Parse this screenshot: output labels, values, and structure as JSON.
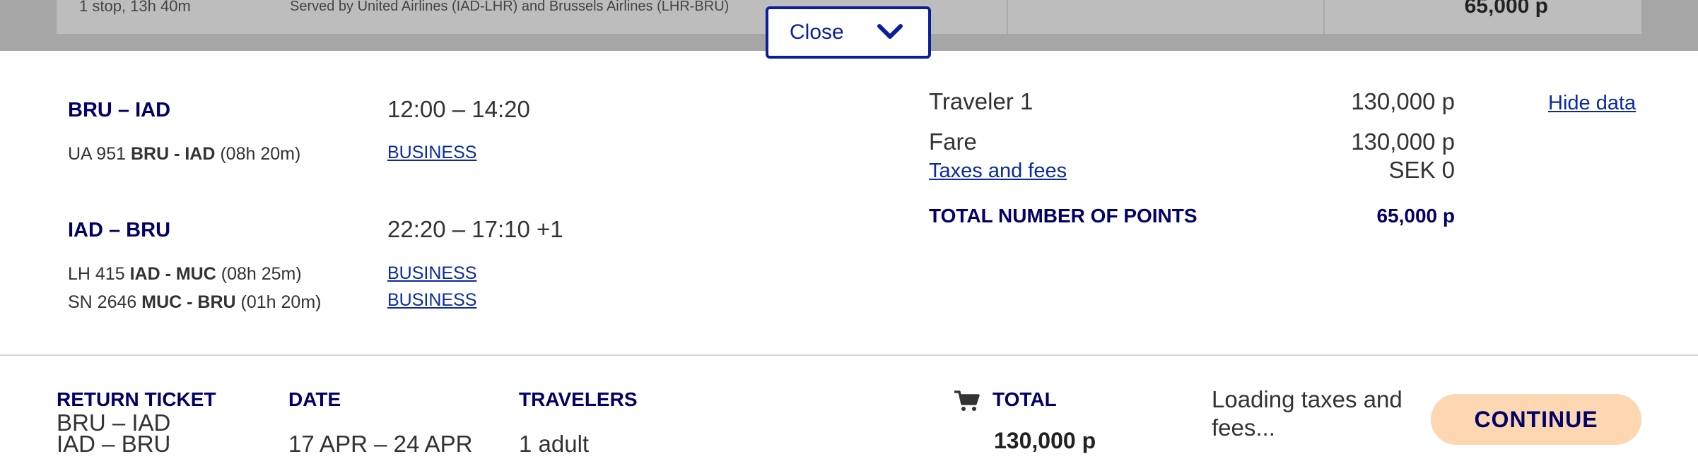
{
  "background_row": {
    "stops": "1 stop, 13h 40m",
    "served_by": "Served by United Airlines (IAD-LHR) and Brussels Airlines (LHR-BRU)",
    "points": "65,000 p"
  },
  "close_toggle": {
    "label": "Close",
    "icon": "chevron-down-icon"
  },
  "itinerary": {
    "outbound": {
      "route": "BRU – IAD",
      "time": "12:00 – 14:20",
      "segments": [
        {
          "flight_no": "UA 951",
          "airports": "BRU - IAD",
          "duration": "(08h 20m)",
          "cabin": "BUSINESS"
        }
      ]
    },
    "inbound": {
      "route": "IAD – BRU",
      "time": "22:20 – 17:10 +1",
      "segments": [
        {
          "flight_no": "LH 415",
          "airports": "IAD - MUC",
          "duration": "(08h 25m)",
          "cabin": "BUSINESS"
        },
        {
          "flight_no": "SN 2646",
          "airports": "MUC - BRU",
          "duration": "(01h 20m)",
          "cabin": "BUSINESS"
        }
      ]
    }
  },
  "price_breakdown": {
    "traveler_label": "Traveler 1",
    "traveler_points": "130,000 p",
    "hide_data_link": "Hide data",
    "fare_label": "Fare",
    "fare_points": "130,000 p",
    "taxes_link": "Taxes and fees",
    "taxes_value": "SEK 0",
    "total_label": "TOTAL NUMBER OF POINTS",
    "total_points": "65,000 p"
  },
  "footer": {
    "ticket_heading": "RETURN TICKET",
    "ticket_routes": [
      "BRU – IAD",
      "IAD – BRU"
    ],
    "date_heading": "DATE",
    "date_value": "17 APR – 24 APR",
    "travelers_heading": "TRAVELERS",
    "travelers_value": "1 adult",
    "cart_icon": "cart-icon",
    "total_heading": "TOTAL",
    "total_value": "130,000 p",
    "status_text": "Loading taxes and fees...",
    "continue_label": "CONTINUE"
  },
  "colors": {
    "navy": "#000066",
    "link_blue": "#0b2a9e",
    "close_border": "#0b1f9e",
    "continue_bg": "#fdd7b2",
    "overlay_gray": "#a6a6a6"
  }
}
